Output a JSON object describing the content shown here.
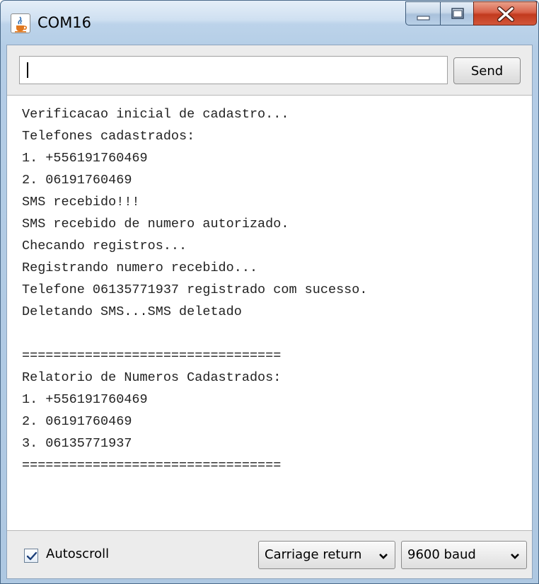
{
  "window": {
    "title": "COM16"
  },
  "send_row": {
    "input_value": "",
    "send_label": "Send"
  },
  "console": {
    "lines": [
      "Verificacao inicial de cadastro...",
      "Telefones cadastrados:",
      "1. +556191760469",
      "2. 06191760469",
      "SMS recebido!!!",
      "SMS recebido de numero autorizado.",
      "Checando registros...",
      "Registrando numero recebido...",
      "Telefone 06135771937 registrado com sucesso.",
      "Deletando SMS...SMS deletado",
      "",
      "=================================",
      "Relatorio de Numeros Cadastrados:",
      "1. +556191760469",
      "2. 06191760469",
      "3. 06135771937",
      "================================="
    ]
  },
  "bottom_bar": {
    "autoscroll_label": "Autoscroll",
    "autoscroll_checked": true,
    "line_ending": "Carriage return",
    "baud_rate": "9600 baud"
  },
  "icons": {
    "app": "java-coffee-cup-icon",
    "minimize": "minimize-icon",
    "maximize": "maximize-icon",
    "close": "close-icon",
    "dropdown": "chevron-down-icon",
    "check": "checkmark-icon"
  },
  "colors": {
    "close_button": "#c23a1e",
    "console_text": "#222222",
    "title_bar": "#cfe0f1"
  }
}
